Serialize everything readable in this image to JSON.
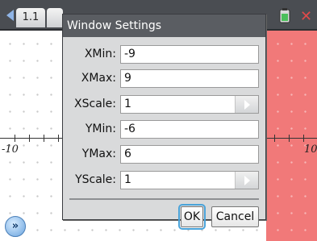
{
  "topbar": {
    "tab_label": "1.1",
    "icons": [
      "back-arrow-icon",
      "battery-icon",
      "close-icon"
    ]
  },
  "graph": {
    "x_min_label": "-10",
    "x_max_label": "10"
  },
  "dialog": {
    "title": "Window Settings",
    "fields": [
      {
        "label": "XMin:",
        "value": "-9"
      },
      {
        "label": "XMax:",
        "value": "9"
      },
      {
        "label": "XScale:",
        "value": "1"
      },
      {
        "label": "YMin:",
        "value": "-6"
      },
      {
        "label": "YMax:",
        "value": "6"
      },
      {
        "label": "YScale:",
        "value": "1"
      }
    ],
    "ok_label": "OK",
    "cancel_label": "Cancel"
  },
  "colors": {
    "accent": "#4aa3d9",
    "graph_right": "#f17979",
    "titlebar": "#5a5d62"
  }
}
